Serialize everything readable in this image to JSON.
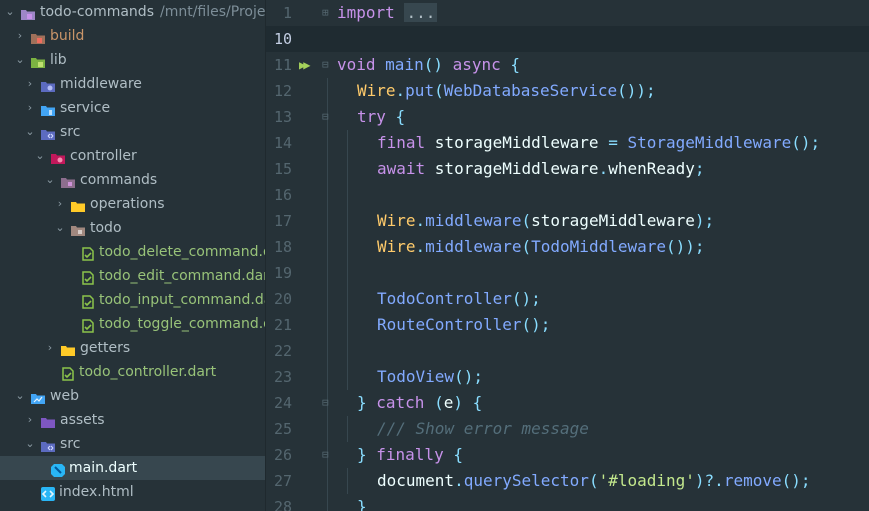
{
  "sidebar": {
    "root": {
      "label": "todo-commands",
      "path": "/mnt/files/Projec"
    },
    "items": [
      {
        "label": "build"
      },
      {
        "label": "lib"
      },
      {
        "label": "middleware"
      },
      {
        "label": "service"
      },
      {
        "label": "src"
      },
      {
        "label": "controller"
      },
      {
        "label": "commands"
      },
      {
        "label": "operations"
      },
      {
        "label": "todo"
      },
      {
        "label": "todo_delete_command.da"
      },
      {
        "label": "todo_edit_command.dart"
      },
      {
        "label": "todo_input_command.da"
      },
      {
        "label": "todo_toggle_command.d"
      },
      {
        "label": "getters"
      },
      {
        "label": "todo_controller.dart"
      },
      {
        "label": "web"
      },
      {
        "label": "assets"
      },
      {
        "label": "src"
      },
      {
        "label": "main.dart"
      },
      {
        "label": "index.html"
      }
    ]
  },
  "editor": {
    "current_line": "10",
    "lines": [
      {
        "num": "1",
        "tokens": [
          [
            "kw",
            "import "
          ],
          [
            "fold",
            "..."
          ]
        ]
      },
      {
        "num": "10",
        "tokens": []
      },
      {
        "num": "11",
        "tokens": [
          [
            "kw",
            "void "
          ],
          [
            "fn",
            "main"
          ],
          [
            "op",
            "() "
          ],
          [
            "kw",
            "async "
          ],
          [
            "op",
            "{"
          ]
        ]
      },
      {
        "num": "12",
        "tokens": [
          [
            "ty",
            "Wire"
          ],
          [
            "op",
            "."
          ],
          [
            "fn",
            "put"
          ],
          [
            "op",
            "("
          ],
          [
            "fn",
            "WebDatabaseService"
          ],
          [
            "op",
            "());"
          ]
        ]
      },
      {
        "num": "13",
        "tokens": [
          [
            "kw",
            "try "
          ],
          [
            "op",
            "{"
          ]
        ]
      },
      {
        "num": "14",
        "tokens": [
          [
            "kw",
            "final "
          ],
          [
            "plain",
            "storageMiddleware "
          ],
          [
            "op",
            "= "
          ],
          [
            "fn",
            "StorageMiddleware"
          ],
          [
            "op",
            "();"
          ]
        ]
      },
      {
        "num": "15",
        "tokens": [
          [
            "kw",
            "await "
          ],
          [
            "plain",
            "storageMiddleware"
          ],
          [
            "op",
            "."
          ],
          [
            "plain",
            "whenReady"
          ],
          [
            "op",
            ";"
          ]
        ]
      },
      {
        "num": "16",
        "tokens": []
      },
      {
        "num": "17",
        "tokens": [
          [
            "ty",
            "Wire"
          ],
          [
            "op",
            "."
          ],
          [
            "fn",
            "middleware"
          ],
          [
            "op",
            "("
          ],
          [
            "plain",
            "storageMiddleware"
          ],
          [
            "op",
            ");"
          ]
        ]
      },
      {
        "num": "18",
        "tokens": [
          [
            "ty",
            "Wire"
          ],
          [
            "op",
            "."
          ],
          [
            "fn",
            "middleware"
          ],
          [
            "op",
            "("
          ],
          [
            "fn",
            "TodoMiddleware"
          ],
          [
            "op",
            "());"
          ]
        ]
      },
      {
        "num": "19",
        "tokens": []
      },
      {
        "num": "20",
        "tokens": [
          [
            "fn",
            "TodoController"
          ],
          [
            "op",
            "();"
          ]
        ]
      },
      {
        "num": "21",
        "tokens": [
          [
            "fn",
            "RouteController"
          ],
          [
            "op",
            "();"
          ]
        ]
      },
      {
        "num": "22",
        "tokens": []
      },
      {
        "num": "23",
        "tokens": [
          [
            "fn",
            "TodoView"
          ],
          [
            "op",
            "();"
          ]
        ]
      },
      {
        "num": "24",
        "tokens": [
          [
            "op",
            "} "
          ],
          [
            "kw",
            "catch "
          ],
          [
            "op",
            "("
          ],
          [
            "plain",
            "e"
          ],
          [
            "op",
            ") {"
          ]
        ]
      },
      {
        "num": "25",
        "tokens": [
          [
            "cmt",
            "/// Show error message"
          ]
        ]
      },
      {
        "num": "26",
        "tokens": [
          [
            "op",
            "} "
          ],
          [
            "kw",
            "finally "
          ],
          [
            "op",
            "{"
          ]
        ]
      },
      {
        "num": "27",
        "tokens": [
          [
            "plain",
            "document"
          ],
          [
            "op",
            "."
          ],
          [
            "fn",
            "querySelector"
          ],
          [
            "op",
            "("
          ],
          [
            "str",
            "'#loading'"
          ],
          [
            "op",
            ")?."
          ],
          [
            "fn",
            "remove"
          ],
          [
            "op",
            "();"
          ]
        ]
      },
      {
        "num": "28",
        "tokens": [
          [
            "op",
            "}"
          ]
        ]
      }
    ]
  },
  "icons": {
    "run": "run-arrows-icon",
    "folder": "folder-icon",
    "dart_test": "dart-test-file-icon",
    "dart": "dart-file-icon",
    "html": "html-file-icon"
  },
  "colors": {
    "background": "#263238",
    "keyword": "#c792ea",
    "function": "#82aaff",
    "type": "#ffcb6b",
    "string": "#c3e88d",
    "comment": "#546e7a",
    "operator": "#89ddff"
  }
}
